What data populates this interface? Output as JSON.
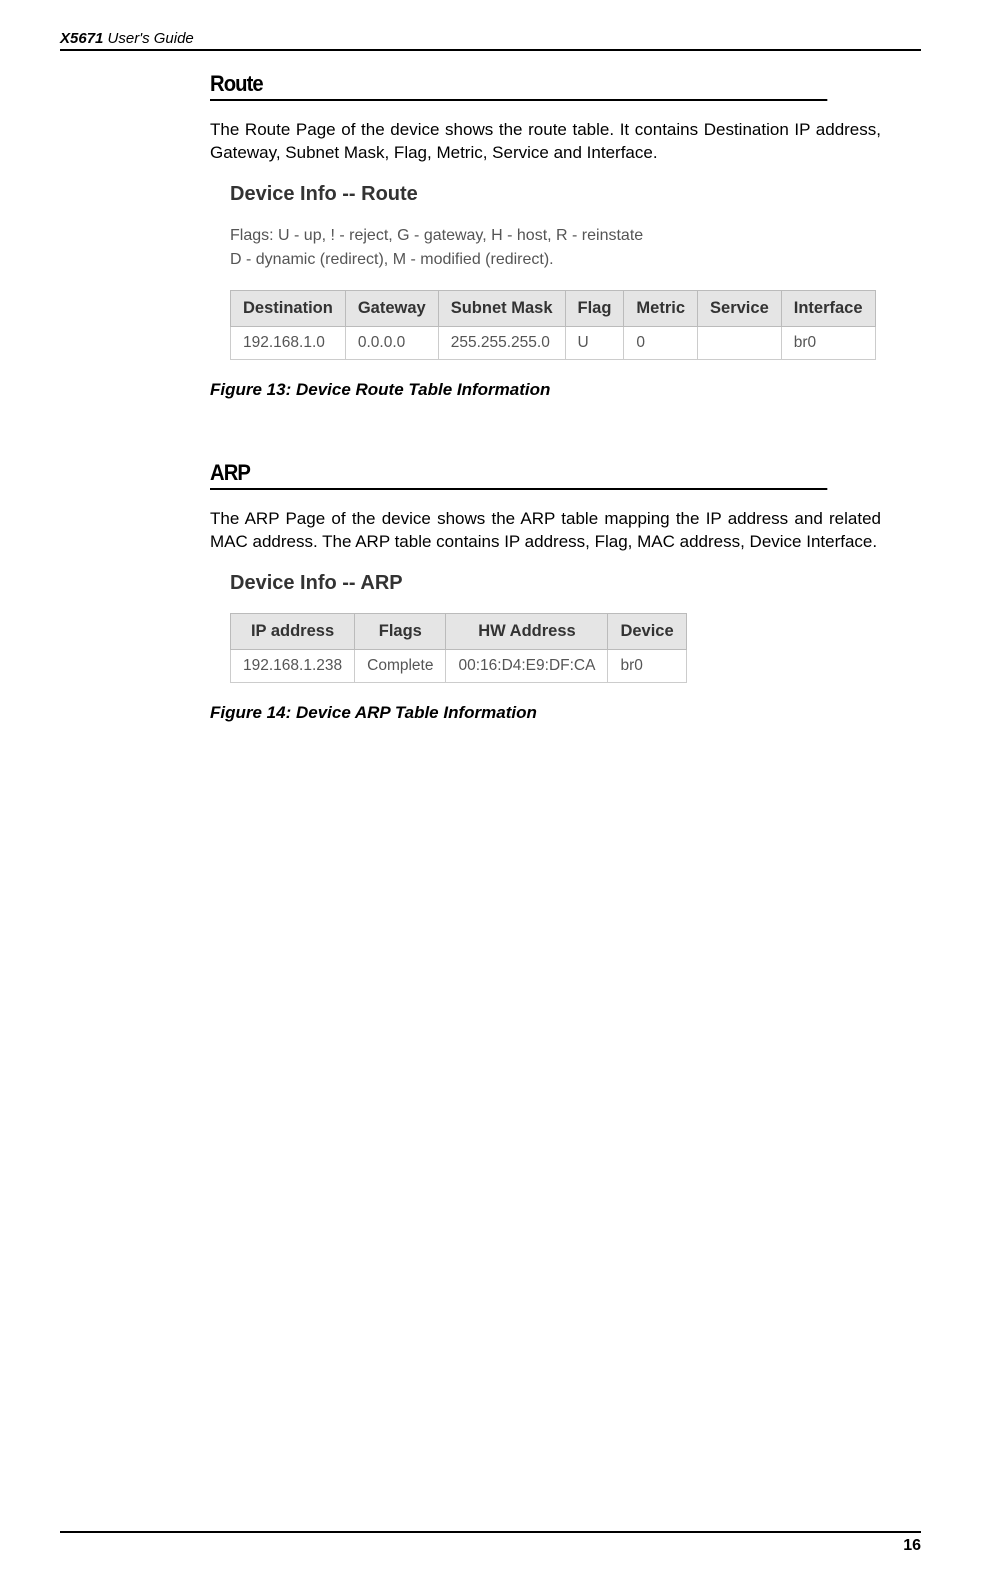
{
  "header": {
    "model": "X5671",
    "guide": " User's Guide"
  },
  "route": {
    "title": "Route",
    "body": "The Route Page of the device shows the route table. It contains Destination IP address, Gateway, Subnet Mask, Flag, Metric, Service and Interface.",
    "shot_title": "Device Info -- Route",
    "shot_sub1": "Flags: U - up, ! - reject, G - gateway, H - host, R - reinstate",
    "shot_sub2": "D - dynamic (redirect), M - modified (redirect).",
    "table": {
      "headers": [
        "Destination",
        "Gateway",
        "Subnet Mask",
        "Flag",
        "Metric",
        "Service",
        "Interface"
      ],
      "row": [
        "192.168.1.0",
        "0.0.0.0",
        "255.255.255.0",
        "U",
        "0",
        "",
        "br0"
      ]
    },
    "caption": "Figure 13: Device Route Table Information"
  },
  "arp": {
    "title": "ARP",
    "body": "The ARP Page of the device shows the ARP table mapping the IP address and related MAC address. The ARP table contains IP address, Flag, MAC address, Device Interface.",
    "shot_title": "Device Info -- ARP",
    "table": {
      "headers": [
        "IP address",
        "Flags",
        "HW Address",
        "Device"
      ],
      "row": [
        "192.168.1.238",
        "Complete",
        "00:16:D4:E9:DF:CA",
        "br0"
      ]
    },
    "caption": "Figure 14: Device ARP Table Information"
  },
  "page_number": "16"
}
